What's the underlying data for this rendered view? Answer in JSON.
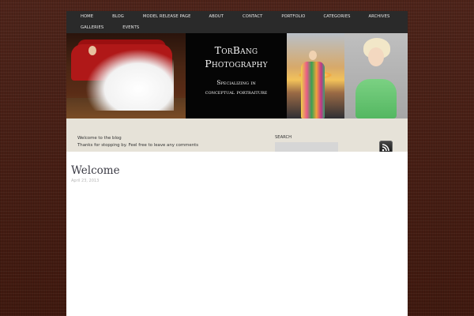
{
  "nav": {
    "items": [
      "HOME",
      "BLOG",
      "MODEL RELEASE PAGE",
      "ABOUT",
      "CONTACT",
      "PORTFOLIO",
      "CATEGORIES",
      "ARCHIVES",
      "GALLERIES",
      "EVENTS"
    ]
  },
  "header": {
    "title_line1": "TorBang",
    "title_line2": "Photography",
    "tagline_line1": "Specializing in",
    "tagline_line2": "conceptual portraiture"
  },
  "infobar": {
    "welcome_line1": "Welcome to the blog",
    "welcome_line2": "Thanks for stopping by. Feel free to leave any comments",
    "search_label": "SEARCH",
    "search_value": "",
    "rss_icon": "rss-icon"
  },
  "post": {
    "title": "Welcome",
    "date": "April 23, 2013"
  },
  "colors": {
    "background": "#4a2218",
    "nav_bg": "#2a2a2a",
    "infobar_bg": "#e6e2d8"
  }
}
